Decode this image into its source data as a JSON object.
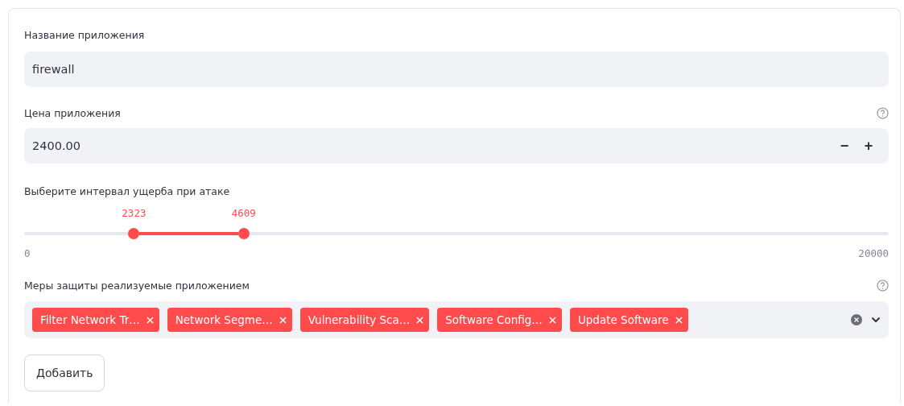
{
  "app_name": {
    "label": "Название приложения",
    "value": "firewall",
    "help": false
  },
  "price": {
    "label": "Цена приложения",
    "value": "2400.00",
    "help": true,
    "minus": "−",
    "plus": "+"
  },
  "damage_range": {
    "label": "Выберите интервал ущерба при атаке",
    "low": {
      "reading": "2323",
      "level": 0.127
    },
    "high": {
      "reading": "4609",
      "level": 0.254
    },
    "min": "0",
    "max": "20000"
  },
  "measures": {
    "label": "Меры защиты реализуемые приложением",
    "help": true,
    "tags": [
      {
        "text": "Filter Network Tr…"
      },
      {
        "text": "Network Segme…"
      },
      {
        "text": "Vulnerability Sca…"
      },
      {
        "text": "Software Config…"
      },
      {
        "text": "Update Software"
      }
    ]
  },
  "submit": {
    "label": "Добавить"
  }
}
